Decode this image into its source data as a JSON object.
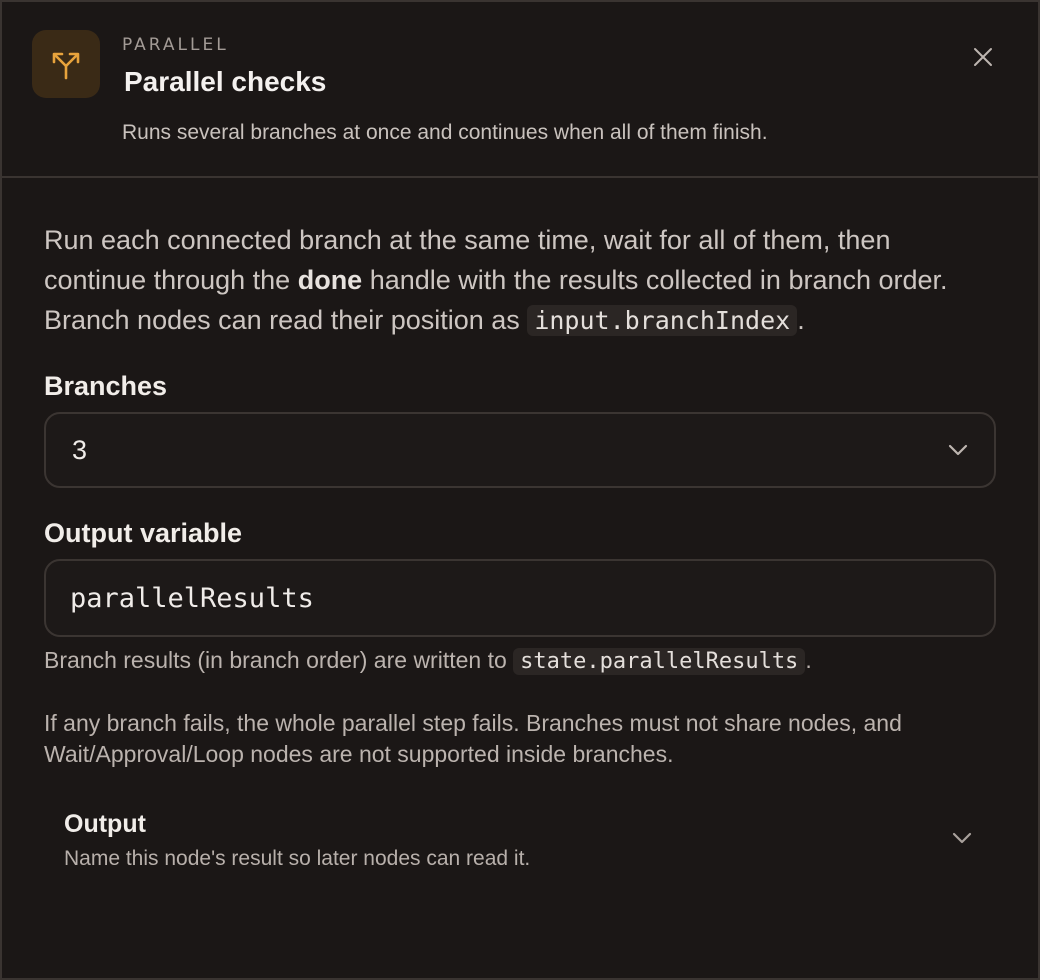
{
  "header": {
    "eyebrow": "PARALLEL",
    "title": "Parallel checks",
    "subtitle": "Runs several branches at once and continues when all of them finish.",
    "icon": "split-branch-icon",
    "accent": "#e8a33c"
  },
  "intro": {
    "part1": "Run each connected branch at the same time, wait for all of them, then continue through the ",
    "bold": "done",
    "part2": " handle with the results collected in branch order. Branch nodes can read their position as ",
    "code": "input.branchIndex",
    "part3": "."
  },
  "branches": {
    "label": "Branches",
    "value": "3"
  },
  "output_variable": {
    "label": "Output variable",
    "value": "parallelResults",
    "help_prefix": "Branch results (in branch order) are written to ",
    "help_code": "state.parallelResults",
    "help_suffix": "."
  },
  "warning": "If any branch fails, the whole parallel step fails. Branches must not share nodes, and Wait/Approval/Loop nodes are not supported inside branches.",
  "output_section": {
    "title": "Output",
    "description": "Name this node's result so later nodes can read it."
  }
}
